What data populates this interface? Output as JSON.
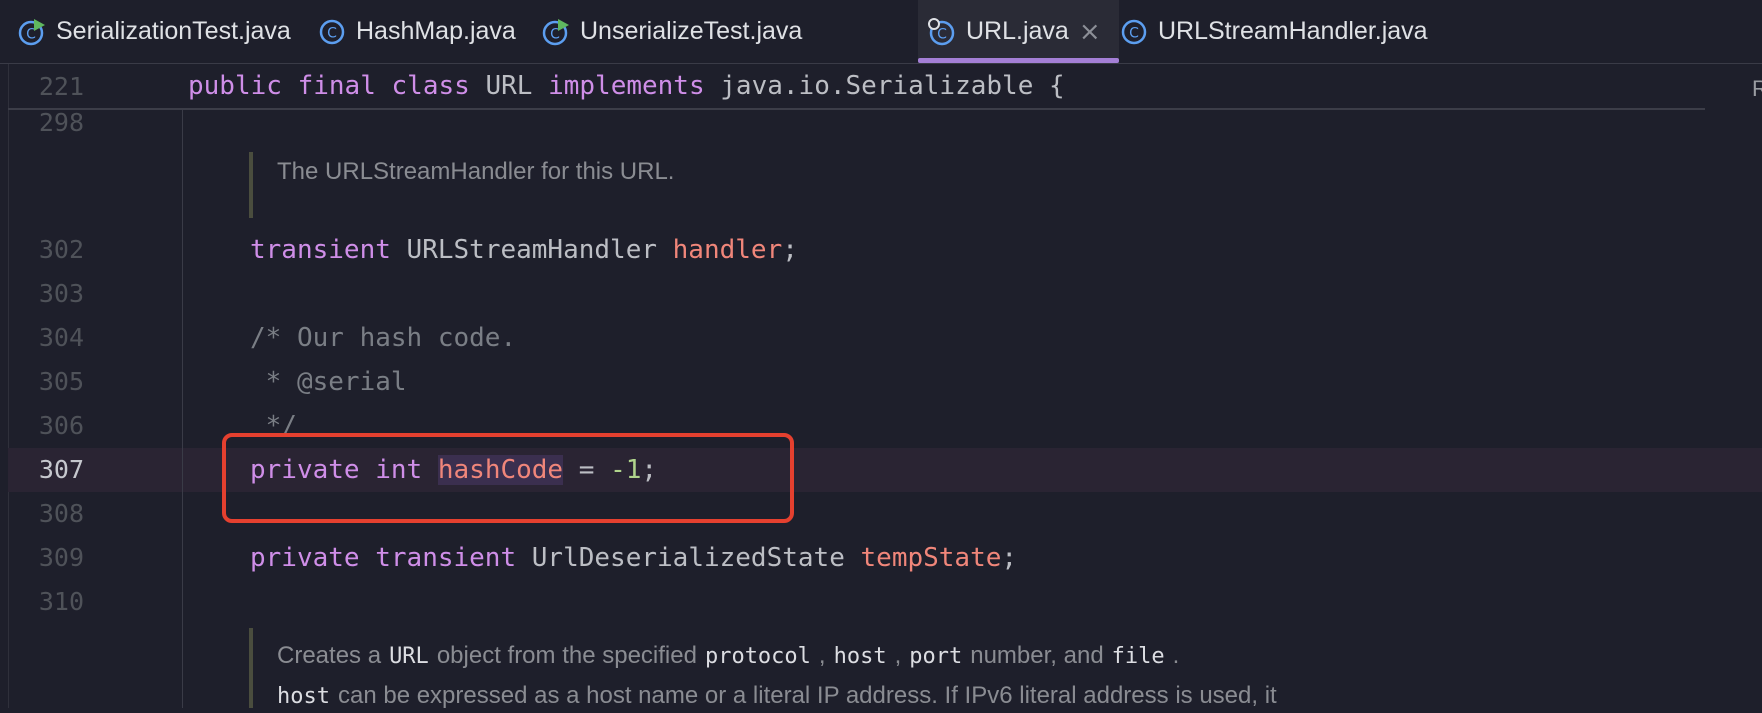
{
  "tabs": [
    {
      "label": "SerializationTest.java",
      "icon": "java-run-class-icon"
    },
    {
      "label": "HashMap.java",
      "icon": "java-class-icon"
    },
    {
      "label": "UnserializeTest.java",
      "icon": "java-run-class-icon"
    },
    {
      "label": "URL.java",
      "icon": "java-class-icon",
      "active": true,
      "close": "×"
    },
    {
      "label": "URLStreamHandler.java",
      "icon": "java-class-icon"
    }
  ],
  "sticky": {
    "line": "221",
    "kw1": "public",
    "kw2": "final",
    "kw3": "class",
    "name": "URL",
    "kw4": "implements",
    "iface": "java.io.Serializable",
    "brace": "{"
  },
  "edge_char": "R",
  "lines": {
    "l298": "298",
    "l302": "302",
    "l303": "303",
    "l304": "304",
    "l305": "305",
    "l306": "306",
    "l307": "307",
    "l308": "308",
    "l309": "309",
    "l310": "310"
  },
  "doc1": "The URLStreamHandler for this URL.",
  "code302": {
    "kw": "transient",
    "type": "URLStreamHandler",
    "field": "handler",
    "end": ";"
  },
  "code304": "/* Our hash code.",
  "code305": " * @serial",
  "code306": " */",
  "code307": {
    "kw1": "private",
    "kw2": "int",
    "field": "hashCode",
    "eq": " = ",
    "num": "-1",
    "end": ";"
  },
  "code309": {
    "kw1": "private",
    "kw2": "transient",
    "type": "UrlDeserializedState",
    "field": "tempState",
    "end": ";"
  },
  "doc2": {
    "t1": "Creates a",
    "c1": "URL",
    "t2": "object from the specified",
    "c2": "protocol",
    "t3": ",",
    "c3": "host",
    "t4": ",",
    "c4": "port",
    "t5": "number, and",
    "c5": "file",
    "t6": ".",
    "c6": "host",
    "t7": "can be expressed as a host name or a literal IP address. If IPv6 literal address is used, it"
  }
}
